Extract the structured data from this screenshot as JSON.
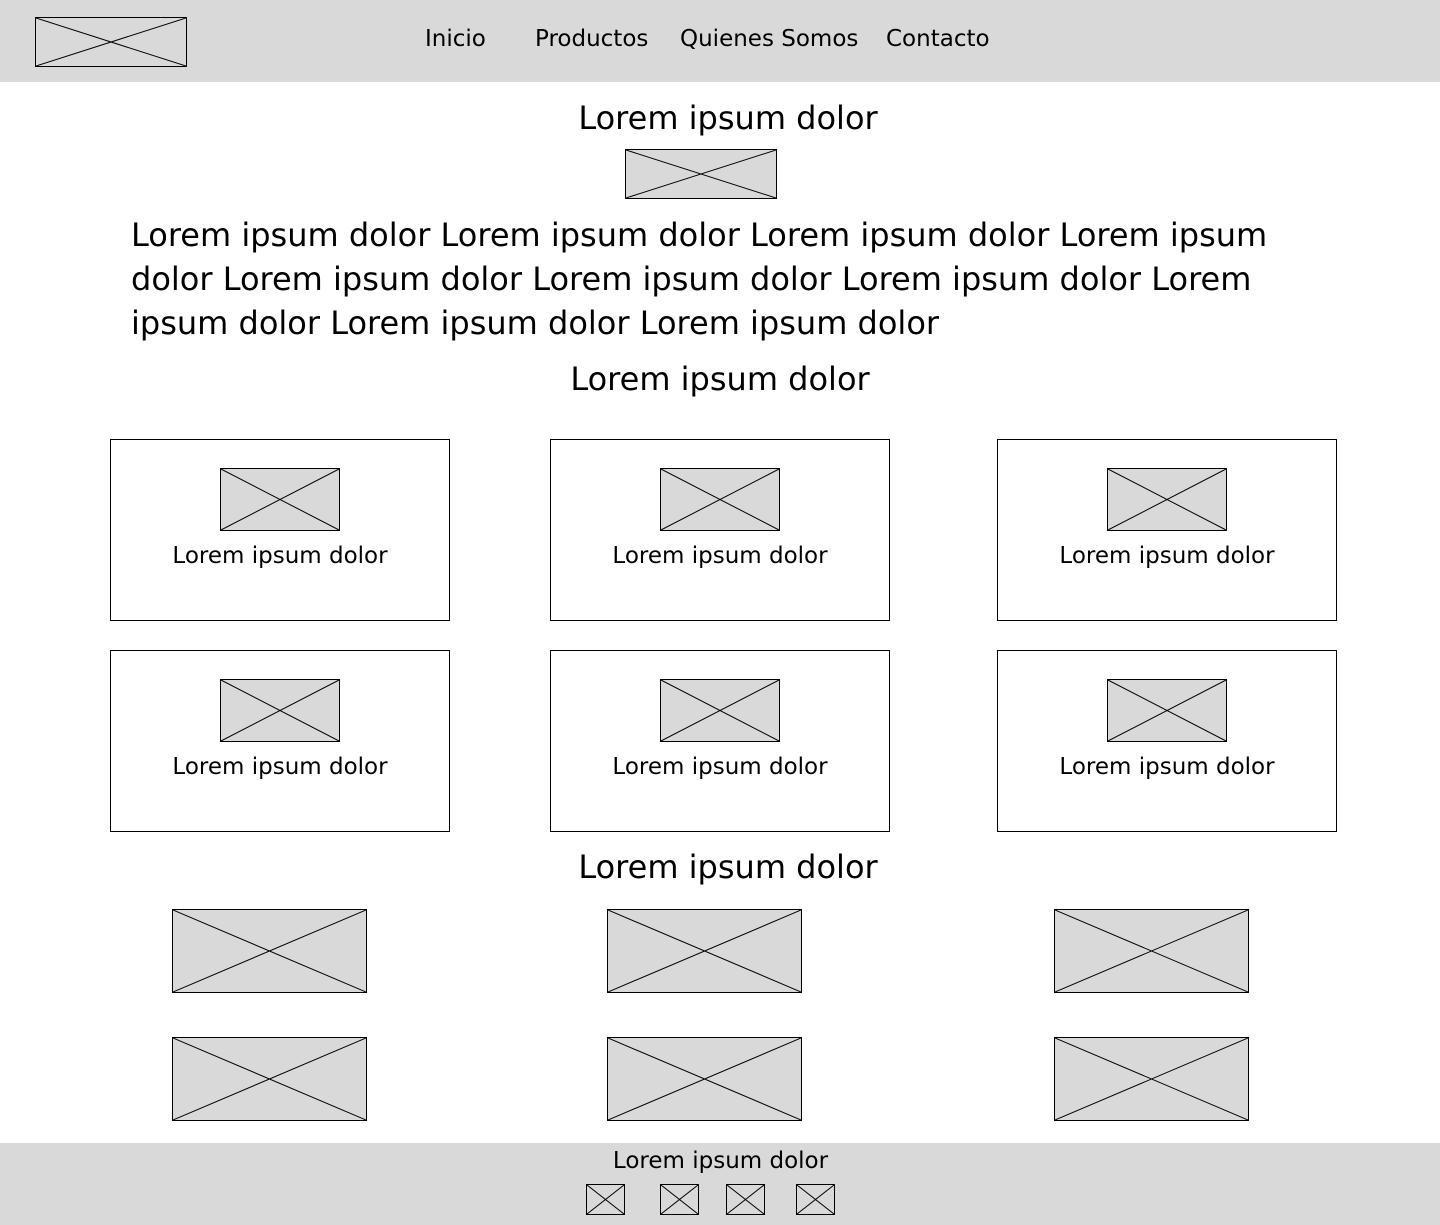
{
  "header": {
    "logo_icon": "image-placeholder-icon",
    "nav": [
      {
        "label": "Inicio"
      },
      {
        "label": "Productos"
      },
      {
        "label": "Quienes Somos"
      },
      {
        "label": "Contacto"
      }
    ]
  },
  "main": {
    "title": "Lorem ipsum dolor",
    "hero_icon": "image-placeholder-icon",
    "intro_text": "Lorem ipsum dolor Lorem ipsum dolor Lorem ipsum dolor Lorem ipsum dolor Lorem ipsum dolor Lorem ipsum dolor Lorem ipsum dolor Lorem ipsum dolor Lorem ipsum dolor Lorem ipsum dolor",
    "section_title": "Lorem ipsum dolor",
    "cards": [
      {
        "label": "Lorem ipsum dolor",
        "icon": "image-placeholder-icon"
      },
      {
        "label": "Lorem ipsum dolor",
        "icon": "image-placeholder-icon"
      },
      {
        "label": "Lorem ipsum dolor",
        "icon": "image-placeholder-icon"
      },
      {
        "label": "Lorem ipsum dolor",
        "icon": "image-placeholder-icon"
      },
      {
        "label": "Lorem ipsum dolor",
        "icon": "image-placeholder-icon"
      },
      {
        "label": "Lorem ipsum dolor",
        "icon": "image-placeholder-icon"
      }
    ],
    "gallery_title": "Lorem ipsum dolor",
    "gallery_icon": "image-placeholder-icon"
  },
  "footer": {
    "text": "Lorem ipsum dolor",
    "social_icon": "image-placeholder-icon"
  },
  "colors": {
    "header_bg": "#d9d9d9",
    "placeholder_fill": "#d9d9d9",
    "text": "#000000",
    "background": "#ffffff"
  }
}
